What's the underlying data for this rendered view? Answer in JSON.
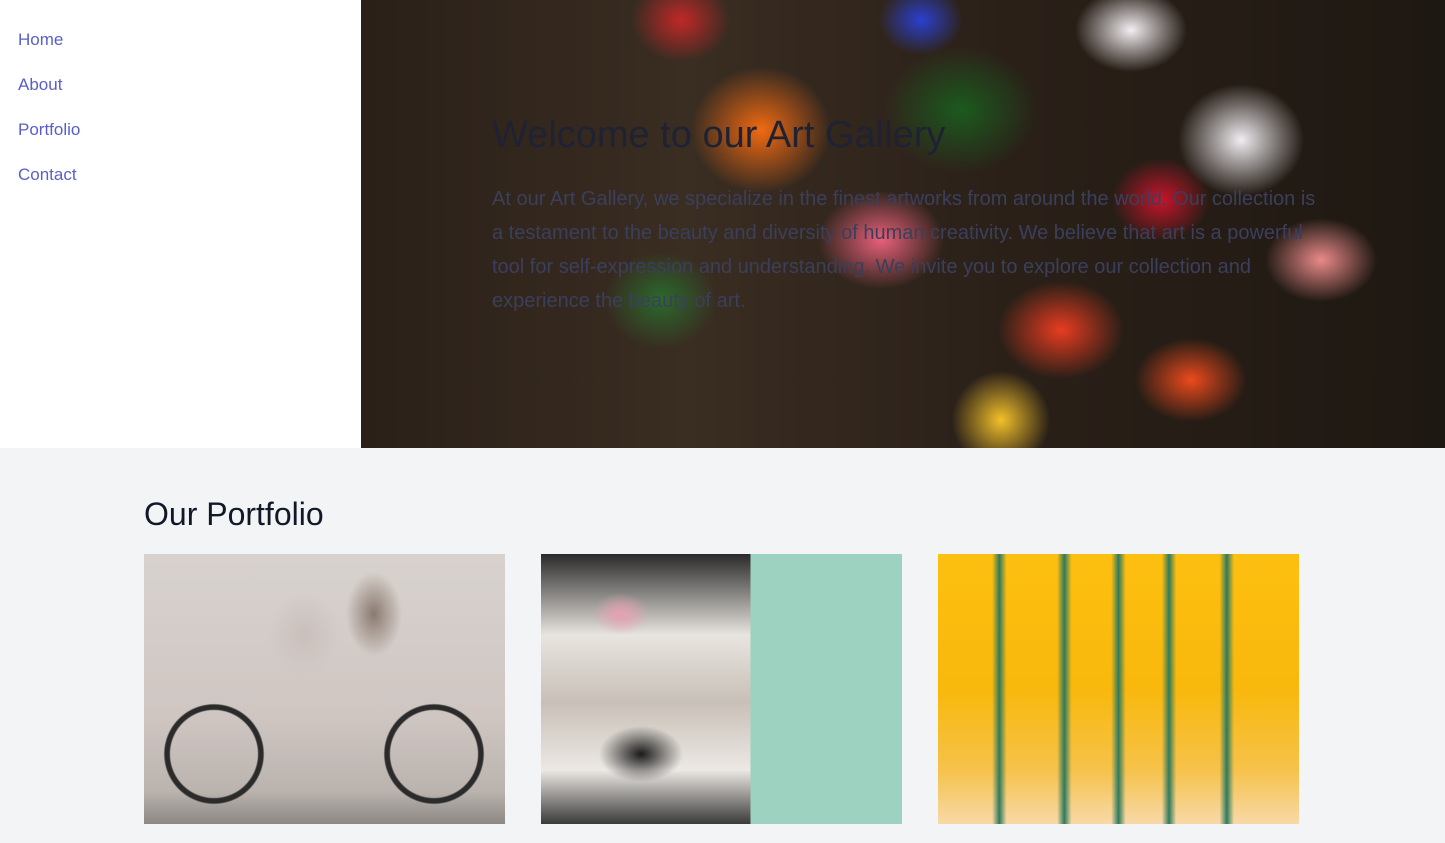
{
  "sidebar": {
    "items": [
      {
        "label": "Home"
      },
      {
        "label": "About"
      },
      {
        "label": "Portfolio"
      },
      {
        "label": "Contact"
      }
    ]
  },
  "hero": {
    "title": "Welcome to our Art Gallery",
    "text": "At our Art Gallery, we specialize in the finest artworks from around the world. Our collection is a testament to the beauty and diversity of human creativity. We believe that art is a powerful tool for self-expression and understanding. We invite you to explore our collection and experience the beauty of art."
  },
  "portfolio": {
    "heading": "Our Portfolio",
    "images": [
      {
        "name": "bicycle-mural-image"
      },
      {
        "name": "poster-collage-image"
      },
      {
        "name": "abstract-paint-image"
      }
    ]
  },
  "colors": {
    "link": "#5a5fc8",
    "page_bg": "#f3f4f6",
    "sidebar_bg": "#ffffff"
  }
}
